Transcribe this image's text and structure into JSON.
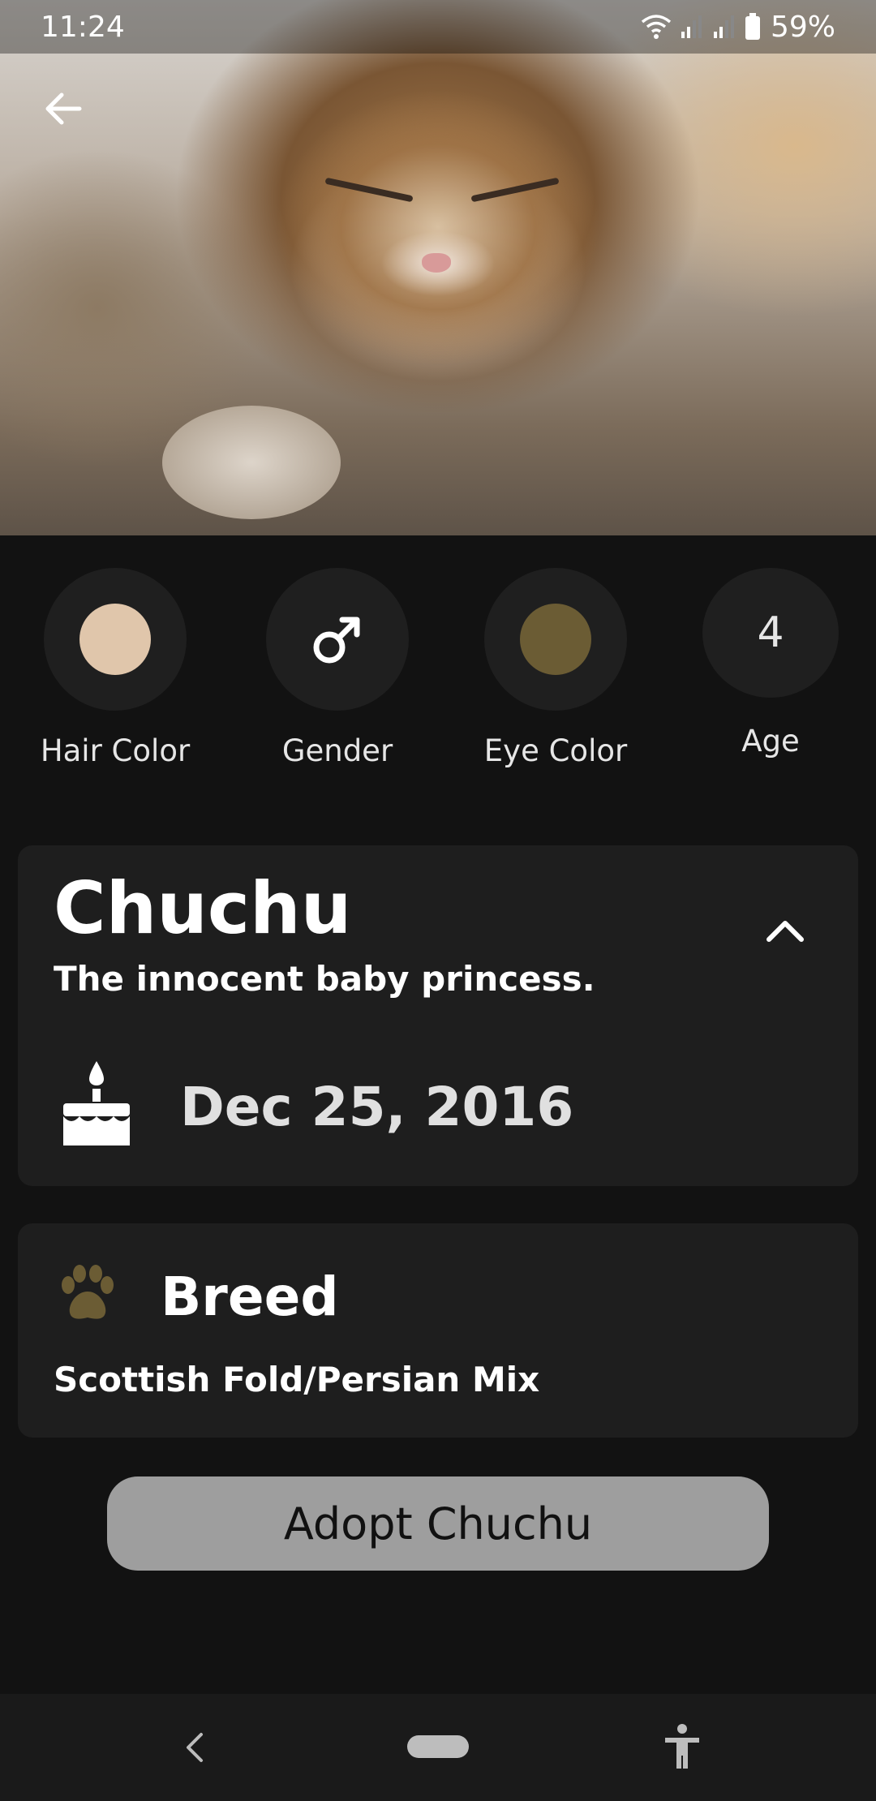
{
  "status_bar": {
    "time": "11:24",
    "battery": "59%",
    "icons": [
      "wifi-icon",
      "signal-icon",
      "signal-icon",
      "battery-icon"
    ]
  },
  "header": {
    "back_icon": "arrow-left-icon",
    "photo": "fluffy calico cat photo"
  },
  "attributes": {
    "hair_color": {
      "label": "Hair Color",
      "swatch": "#e0c6ab"
    },
    "gender": {
      "label": "Gender",
      "icon": "male-symbol-icon"
    },
    "eye_color": {
      "label": "Eye Color",
      "swatch": "#6b5c34"
    },
    "age": {
      "label": "Age",
      "value": "4"
    }
  },
  "profile": {
    "name": "Chuchu",
    "tagline": "The innocent baby princess.",
    "birthday": "Dec 25, 2016",
    "collapse_icon": "chevron-up-icon",
    "birthday_icon": "cake-icon"
  },
  "breed": {
    "title": "Breed",
    "value": "Scottish Fold/Persian Mix",
    "icon": "paw-icon",
    "icon_color": "#6b5c34"
  },
  "adopt_button": {
    "label": "Adopt Chuchu"
  },
  "nav_bar": {
    "back_icon": "nav-back-icon",
    "home_icon": "nav-home-pill",
    "accessibility_icon": "accessibility-icon"
  },
  "colors": {
    "background": "#121212",
    "card": "#1e1e1e",
    "circle": "#1f1f1f",
    "button": "#9e9e9e"
  }
}
